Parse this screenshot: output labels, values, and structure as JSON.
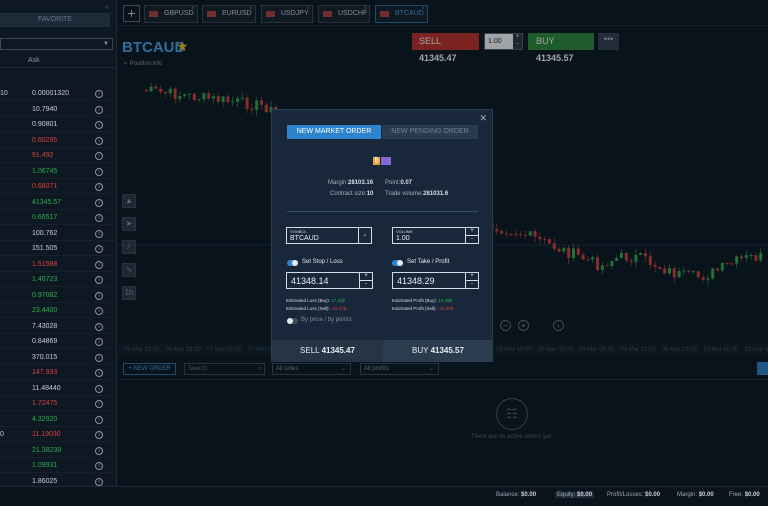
{
  "sidebar": {
    "favorite_label": "FAVORITE",
    "filter_value": "",
    "ask_header": "Ask",
    "rows": [
      {
        "bid": "10",
        "ask": "0.00001320",
        "trend": "nt"
      },
      {
        "bid": "",
        "ask": "10.7940",
        "trend": "nt"
      },
      {
        "bid": "",
        "ask": "0.90801",
        "trend": "nt"
      },
      {
        "bid": "",
        "ask": "0.60295",
        "trend": "dn"
      },
      {
        "bid": "",
        "ask": "91.492",
        "trend": "dn"
      },
      {
        "bid": "",
        "ask": "1.06745",
        "trend": "up"
      },
      {
        "bid": "",
        "ask": "0.68071",
        "trend": "dn"
      },
      {
        "bid": "",
        "ask": "41345.57",
        "trend": "up"
      },
      {
        "bid": "",
        "ask": "0.66517",
        "trend": "up"
      },
      {
        "bid": "",
        "ask": "100.762",
        "trend": "nt"
      },
      {
        "bid": "",
        "ask": "151.505",
        "trend": "nt"
      },
      {
        "bid": "",
        "ask": "1.51588",
        "trend": "dn"
      },
      {
        "bid": "",
        "ask": "1.46723",
        "trend": "up"
      },
      {
        "bid": "",
        "ask": "0.97082",
        "trend": "up"
      },
      {
        "bid": "",
        "ask": "23.4400",
        "trend": "up"
      },
      {
        "bid": "",
        "ask": "7.43028",
        "trend": "nt"
      },
      {
        "bid": "",
        "ask": "0.84869",
        "trend": "nt"
      },
      {
        "bid": "",
        "ask": "370.015",
        "trend": "nt"
      },
      {
        "bid": "",
        "ask": "147.933",
        "trend": "dn"
      },
      {
        "bid": "",
        "ask": "11.48440",
        "trend": "nt"
      },
      {
        "bid": "",
        "ask": "1.72475",
        "trend": "dn"
      },
      {
        "bid": "",
        "ask": "4.32920",
        "trend": "up"
      },
      {
        "bid": "0",
        "ask": "11.19030",
        "trend": "dn"
      },
      {
        "bid": "",
        "ask": "21.38239",
        "trend": "up"
      },
      {
        "bid": "",
        "ask": "1.09931",
        "trend": "up"
      },
      {
        "bid": "",
        "ask": "1.86025",
        "trend": "nt"
      }
    ]
  },
  "tabs": [
    {
      "label": "GBPUSD",
      "active": false
    },
    {
      "label": "EURUSD",
      "active": false
    },
    {
      "label": "USDJPY",
      "active": false
    },
    {
      "label": "USDCHF",
      "active": false
    },
    {
      "label": "BTCAUD",
      "active": true
    }
  ],
  "instrument": {
    "symbol": "BTCAUD",
    "position_info": "Position info",
    "sell_label": "SELL",
    "sell_price": "41345.47",
    "volume": "1.00",
    "buy_label": "BUY",
    "buy_price": "41345.57",
    "more": "•••"
  },
  "time_axis": [
    "06 Mar 12:00",
    "06 Mar 18:00",
    "07 Mar 00:00",
    "07 Mar 06:00",
    "07 Mar 12:00",
    "07 Mar 18:00",
    "08 Mar 00:00",
    "08 Mar 06:00",
    "08 Mar 12:00",
    "08 Mar 18:00",
    "09 Mar 00:00",
    "09 Mar 06:00",
    "09 Mar 12:00",
    "09 Mar 18:00",
    "10 Mar 00:00",
    "10 Mar 06:00",
    "10 Mar 12:00",
    "10 Mar 18:00",
    "11 Mar 00:00"
  ],
  "orders": {
    "new_order": "+ NEW ORDER",
    "search_placeholder": "Search",
    "side_filter": "All sides",
    "profit_filter": "All profits",
    "empty_message": "There are no active orders yet"
  },
  "status": {
    "balance_label": "Balance:",
    "balance": "$0.00",
    "equity_label": "Equity:",
    "equity": "$0.00",
    "pl_label": "Profit/Losses:",
    "pl": "$0.00",
    "margin_label": "Margin:",
    "margin": "$0.00",
    "free_label": "Free:",
    "free": "$0.00"
  },
  "modal": {
    "tab_market": "NEW MARKET ORDER",
    "tab_pending": "NEW PENDING ORDER",
    "margin_label": "Margin:",
    "margin": "28103.16",
    "point_label": "Point:",
    "point": "0.07",
    "contract_label": "Contract size:",
    "contract": "10",
    "trade_volume_label": "Trade volume:",
    "trade_volume": "281031.6",
    "symbol_label": "SYMBOL",
    "symbol": "BTCAUD",
    "volume_label": "VOLUME",
    "volume": "1.00",
    "stop_loss_label": "Set Stop / Loss",
    "take_profit_label": "Set Take / Profit",
    "stop_loss_value": "41348.14",
    "take_profit_value": "41348.29",
    "est_loss_buy_label": "Estimated Loss (Buy):",
    "est_loss_buy": "17.42$",
    "est_loss_sell_label": "Estimated Loss (Sell):",
    "est_loss_sell": "-16.17$",
    "est_profit_buy_label": "Estimated Profit (Buy):",
    "est_profit_buy": "18.48$",
    "est_profit_sell_label": "Estimated Profit (Sell):",
    "est_profit_sell": "-16.20$",
    "by_price_label": "By price / by points",
    "sell_label": "SELL",
    "sell_price": "41345.47",
    "buy_label": "BUY",
    "buy_price": "41345.57"
  },
  "colors": {
    "accent": "#2e84cc",
    "up": "#2fae4c",
    "down": "#d8413b",
    "sell": "#c12f29",
    "buy": "#2e8b3a"
  }
}
